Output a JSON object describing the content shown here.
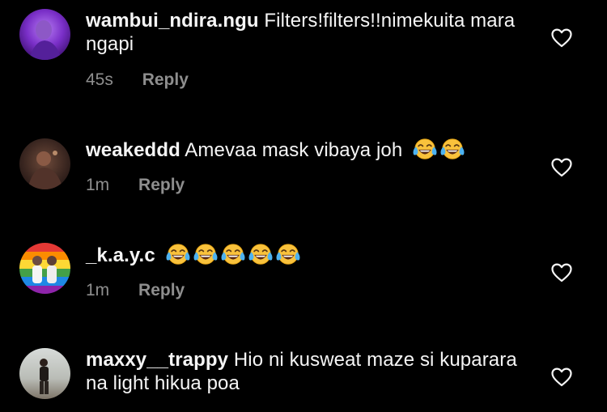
{
  "colors": {
    "background": "#000000",
    "text_primary": "#f5f5f5",
    "text_secondary": "#8e8e8e"
  },
  "comments": [
    {
      "username": "wambui_ndira.ngu",
      "text": "Filters!filters!!nimekuita mara ngapi",
      "time": "45s",
      "reply_label": "Reply",
      "emoji": [],
      "like_icon": "heart-outline-icon"
    },
    {
      "username": "weakeddd",
      "text": "Amevaa mask vibaya joh",
      "time": "1m",
      "reply_label": "Reply",
      "emoji": [
        "tears-of-joy",
        "tears-of-joy"
      ],
      "like_icon": "heart-outline-icon"
    },
    {
      "username": "_k.a.y.c",
      "text": "",
      "time": "1m",
      "reply_label": "Reply",
      "emoji": [
        "tears-of-joy",
        "tears-of-joy",
        "tears-of-joy",
        "tears-of-joy",
        "tears-of-joy"
      ],
      "like_icon": "heart-outline-icon"
    },
    {
      "username": "maxxy__trappy",
      "text": "Hio ni kusweat maze si kuparara na light hikua poa",
      "time": "",
      "reply_label": "",
      "emoji": [],
      "like_icon": "heart-outline-icon"
    }
  ]
}
